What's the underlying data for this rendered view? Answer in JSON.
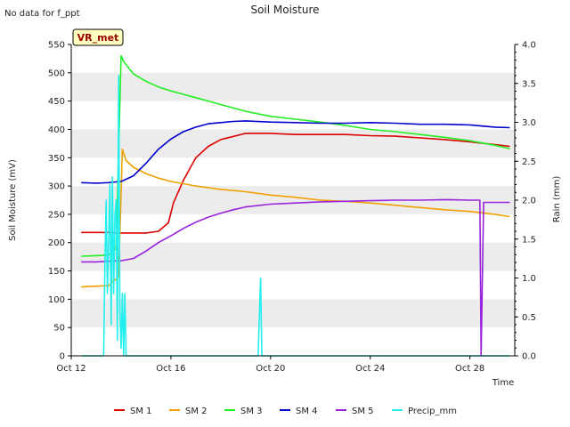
{
  "chart_data": {
    "type": "line",
    "title": "Soil Moisture",
    "note": "No data for f_ppt",
    "badge": "VR_met",
    "xlabel": "Time",
    "ylabel": "Soil Moisture (mV)",
    "y2label": "Rain (mm)",
    "xlim": [
      "2023-10-12",
      "2023-10-29.8"
    ],
    "ylim": [
      0,
      550
    ],
    "y2lim": [
      0,
      4.0
    ],
    "x_ticks": [
      "Oct 12",
      "Oct 16",
      "Oct 20",
      "Oct 24",
      "Oct 28"
    ],
    "x_tick_days": [
      12,
      16,
      20,
      24,
      28
    ],
    "y_ticks": [
      0,
      50,
      100,
      150,
      200,
      250,
      300,
      350,
      400,
      450,
      500,
      550
    ],
    "y2_ticks": [
      "0.0",
      "0.5",
      "1.0",
      "1.5",
      "2.0",
      "2.5",
      "3.0",
      "3.5",
      "4.0"
    ],
    "grid_bands": true,
    "legend_position": "bottom",
    "series": [
      {
        "name": "SM 1",
        "color": "#dd0000",
        "axis": "left",
        "x": [
          12.4,
          13.0,
          13.5,
          14.0,
          15.0,
          15.5,
          15.9,
          16.1,
          16.5,
          17.0,
          17.5,
          18.0,
          19.0,
          20.0,
          21.0,
          22.0,
          23.0,
          24.0,
          25.0,
          26.0,
          27.0,
          28.0,
          29.0,
          29.6
        ],
        "y": [
          218,
          218,
          218,
          217,
          217,
          220,
          235,
          270,
          310,
          350,
          370,
          382,
          393,
          393,
          391,
          391,
          391,
          389,
          388,
          385,
          382,
          378,
          373,
          370
        ]
      },
      {
        "name": "SM 2",
        "color": "#f0a000",
        "axis": "left",
        "x": [
          12.4,
          13.0,
          13.5,
          13.9,
          14.05,
          14.2,
          14.5,
          15.0,
          15.5,
          16.0,
          16.5,
          17.0,
          17.5,
          18.0,
          19.0,
          20.0,
          21.0,
          22.0,
          23.0,
          24.0,
          25.0,
          26.0,
          27.0,
          28.0,
          29.0,
          29.6
        ],
        "y": [
          122,
          123,
          124,
          140,
          365,
          345,
          333,
          322,
          314,
          308,
          304,
          300,
          297,
          294,
          290,
          284,
          280,
          275,
          273,
          270,
          266,
          262,
          258,
          255,
          250,
          246
        ]
      },
      {
        "name": "SM 3",
        "color": "#22ee22",
        "axis": "left",
        "x": [
          12.4,
          13.0,
          13.5,
          13.8,
          14.0,
          14.1,
          14.5,
          15.0,
          15.5,
          16.0,
          16.5,
          17.0,
          17.5,
          18.0,
          19.0,
          20.0,
          21.0,
          22.0,
          23.0,
          24.0,
          25.0,
          26.0,
          27.0,
          28.0,
          29.0,
          29.6
        ],
        "y": [
          176,
          177,
          178,
          190,
          530,
          520,
          498,
          485,
          475,
          468,
          462,
          456,
          450,
          444,
          432,
          423,
          418,
          413,
          407,
          400,
          396,
          391,
          386,
          380,
          372,
          366
        ]
      },
      {
        "name": "SM 4",
        "color": "#0000cc",
        "axis": "left",
        "x": [
          12.4,
          13.0,
          13.5,
          14.0,
          14.5,
          15.0,
          15.5,
          16.0,
          16.5,
          17.0,
          17.5,
          18.0,
          18.5,
          19.0,
          20.0,
          21.0,
          22.0,
          23.0,
          24.0,
          25.0,
          26.0,
          27.0,
          28.0,
          29.0,
          29.6
        ],
        "y": [
          306,
          305,
          306,
          308,
          318,
          340,
          365,
          383,
          396,
          404,
          410,
          412,
          414,
          415,
          413,
          412,
          411,
          411,
          412,
          411,
          409,
          409,
          408,
          404,
          403
        ]
      },
      {
        "name": "SM 5",
        "color": "#9922dd",
        "axis": "left",
        "x": [
          12.4,
          13.0,
          13.5,
          14.0,
          14.5,
          15.0,
          15.5,
          16.0,
          16.5,
          17.0,
          17.5,
          18.0,
          18.5,
          19.0,
          20.0,
          21.0,
          22.0,
          23.0,
          24.0,
          25.0,
          26.0,
          27.0,
          28.0,
          28.4,
          28.45,
          28.55,
          29.6
        ],
        "y": [
          166,
          166,
          167,
          168,
          172,
          185,
          200,
          212,
          225,
          236,
          245,
          252,
          258,
          263,
          268,
          270,
          272,
          273,
          274,
          275,
          275,
          276,
          275,
          275,
          0,
          271,
          271
        ]
      },
      {
        "name": "Precip_mm",
        "color": "#22eeee",
        "axis": "right",
        "x": [
          12.4,
          13.3,
          13.35,
          13.4,
          13.45,
          13.5,
          13.55,
          13.6,
          13.65,
          13.7,
          13.75,
          13.8,
          13.85,
          13.9,
          13.95,
          14.0,
          14.05,
          14.1,
          14.15,
          14.2,
          14.25,
          19.5,
          19.55,
          19.6,
          19.65,
          19.7,
          29.6
        ],
        "y": [
          0,
          0,
          1.2,
          2.0,
          0.8,
          1.5,
          2.2,
          0.4,
          2.3,
          0.8,
          1.8,
          2.0,
          0.2,
          3.6,
          0.6,
          0.1,
          0.8,
          0.0,
          0.8,
          0.0,
          0,
          0,
          0.5,
          1.0,
          0.0,
          0,
          0
        ]
      }
    ]
  }
}
